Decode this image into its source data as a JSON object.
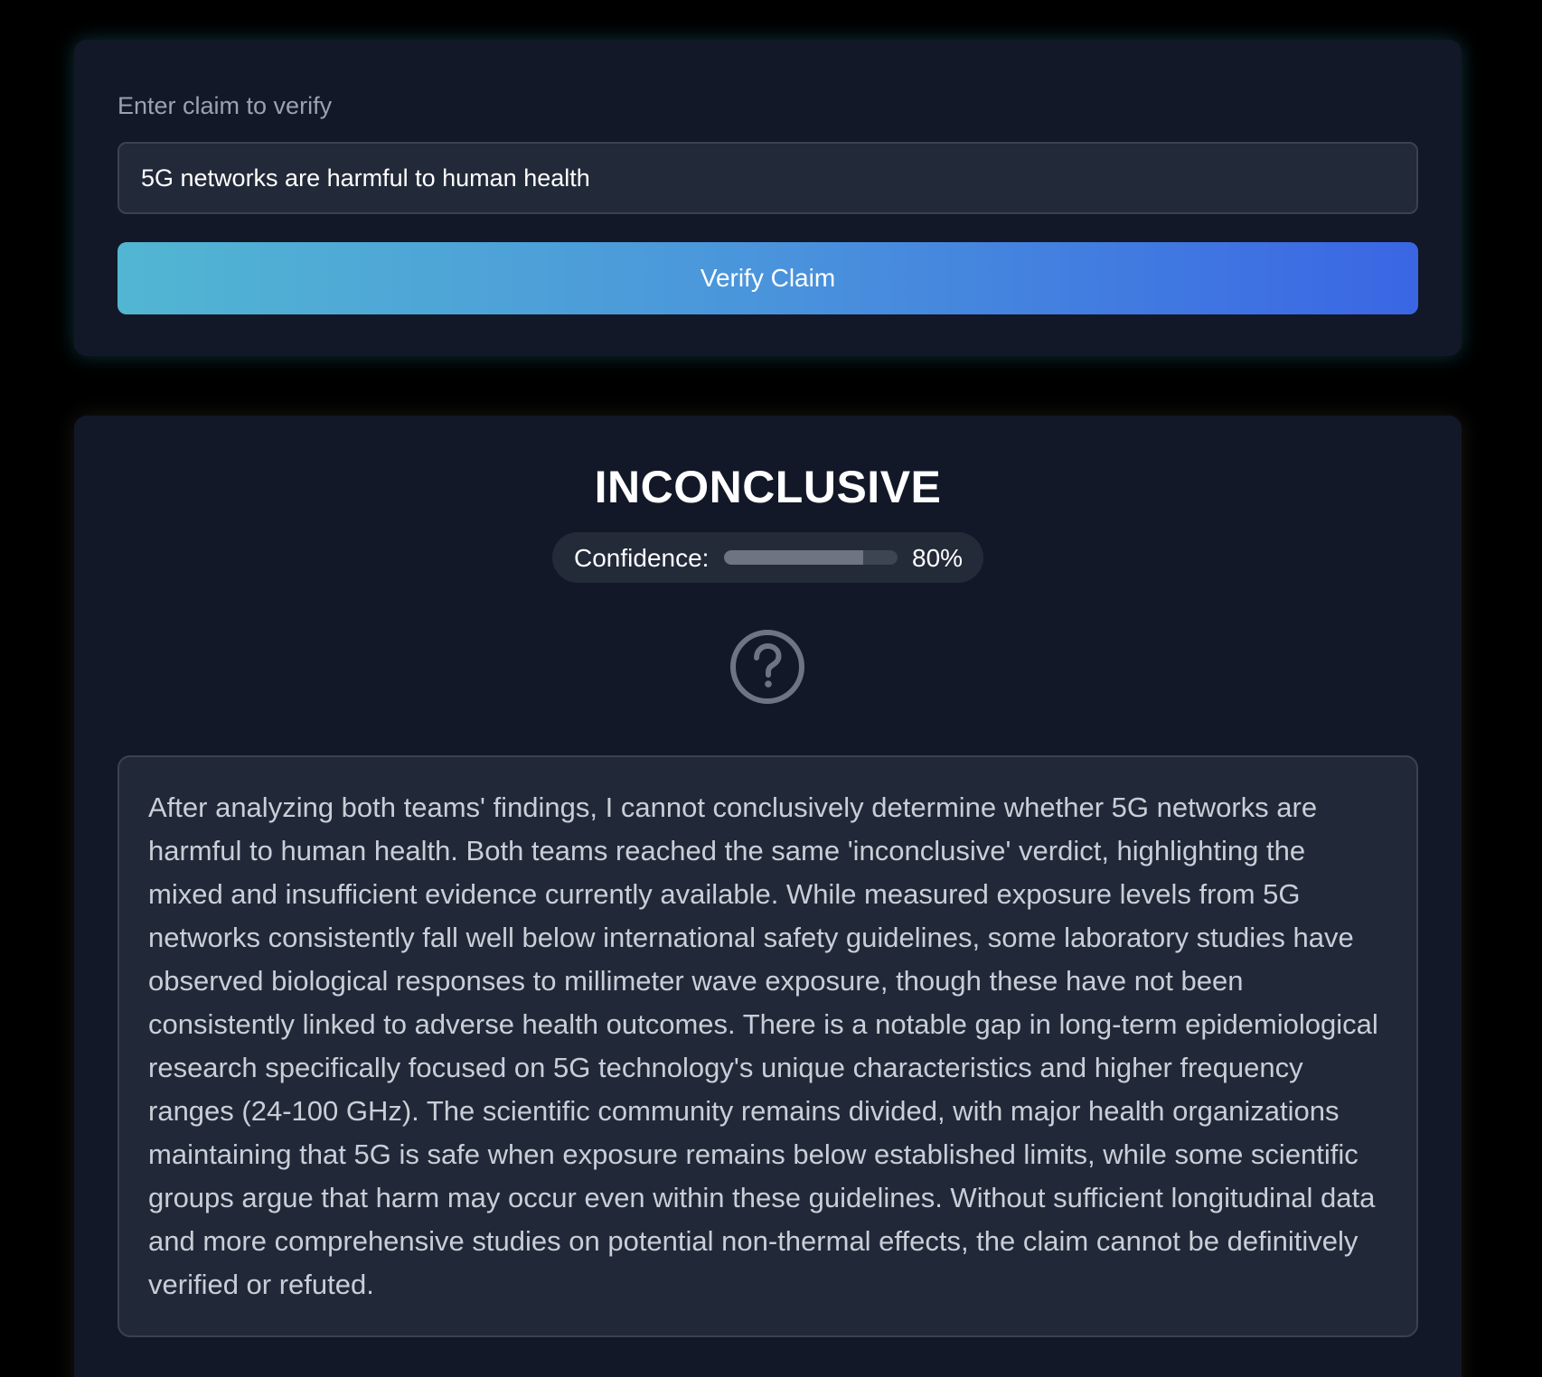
{
  "claim_form": {
    "label": "Enter claim to verify",
    "input_value": "5G networks are harmful to human health",
    "button_label": "Verify Claim"
  },
  "result": {
    "verdict": "INCONCLUSIVE",
    "confidence_label": "Confidence:",
    "confidence_value": "80%",
    "confidence_fraction": 0.8,
    "status_icon": "question-circle-icon",
    "explanation": "After analyzing both teams' findings, I cannot conclusively determine whether 5G networks are harmful to human health. Both teams reached the same 'inconclusive' verdict, highlighting the mixed and insufficient evidence currently available. While measured exposure levels from 5G networks consistently fall well below international safety guidelines, some laboratory studies have observed biological responses to millimeter wave exposure, though these have not been consistently linked to adverse health outcomes. There is a notable gap in long-term epidemiological research specifically focused on 5G technology's unique characteristics and higher frequency ranges (24-100 GHz). The scientific community remains divided, with major health organizations maintaining that 5G is safe when exposure remains below established limits, while some scientific groups argue that harm may occur even within these guidelines. Without sufficient longitudinal data and more comprehensive studies on potential non-thermal effects, the claim cannot be definitively verified or refuted."
  },
  "colors": {
    "background": "#000000",
    "card": "#121827",
    "button_gradient_start": "#52b6d2",
    "button_gradient_end": "#3a66e4",
    "confidence_fill": "#6e7482",
    "icon": "#6e7482"
  }
}
